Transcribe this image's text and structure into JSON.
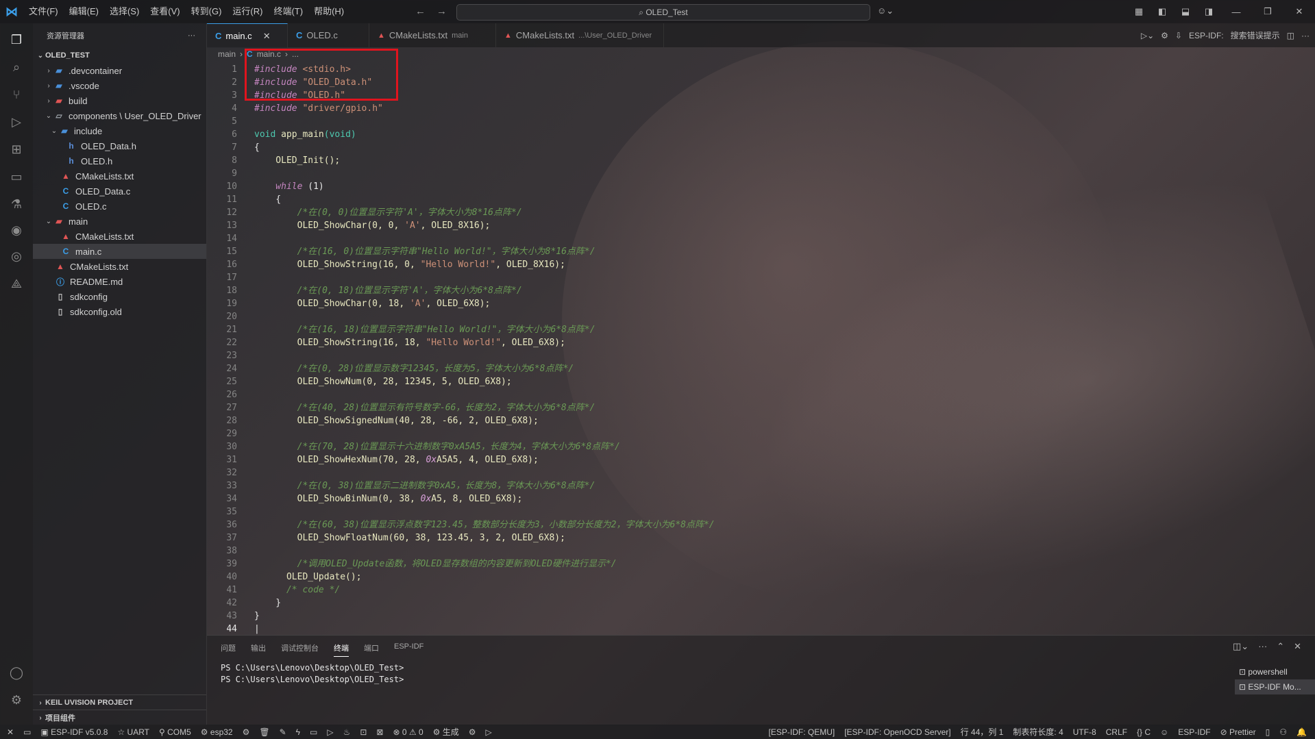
{
  "titlebar": {
    "menu": [
      "文件(F)",
      "编辑(E)",
      "选择(S)",
      "查看(V)",
      "转到(G)",
      "运行(R)",
      "终端(T)",
      "帮助(H)"
    ],
    "search_text": "OLED_Test"
  },
  "sidebar": {
    "title": "资源管理器",
    "root": "OLED_TEST",
    "items": [
      {
        "label": ".devcontainer"
      },
      {
        "label": ".vscode"
      },
      {
        "label": "build"
      },
      {
        "label": "components \\ User_OLED_Driver"
      },
      {
        "label": "include"
      },
      {
        "label": "OLED_Data.h"
      },
      {
        "label": "OLED.h"
      },
      {
        "label": "CMakeLists.txt"
      },
      {
        "label": "OLED_Data.c"
      },
      {
        "label": "OLED.c"
      },
      {
        "label": "main"
      },
      {
        "label": "CMakeLists.txt"
      },
      {
        "label": "main.c"
      },
      {
        "label": "CMakeLists.txt"
      },
      {
        "label": "README.md"
      },
      {
        "label": "sdkconfig"
      },
      {
        "label": "sdkconfig.old"
      }
    ],
    "sections": [
      "KEIL UVISION PROJECT",
      "项目组件"
    ]
  },
  "tabs": [
    {
      "label": "main.c",
      "desc": ""
    },
    {
      "label": "OLED.c",
      "desc": ""
    },
    {
      "label": "CMakeLists.txt",
      "desc": "main"
    },
    {
      "label": "CMakeLists.txt",
      "desc": "...\\User_OLED_Driver"
    }
  ],
  "editor_actions": {
    "esp_idf": "ESP-IDF:",
    "search_hint": "搜索错误提示"
  },
  "breadcrumb": {
    "folder": "main",
    "file": "main.c",
    "more": "..."
  },
  "code": {
    "line_numbers": [
      "1",
      "2",
      "3",
      "4",
      "5",
      "6",
      "7",
      "8",
      "9",
      "10",
      "11",
      "12",
      "13",
      "14",
      "15",
      "16",
      "17",
      "18",
      "19",
      "20",
      "21",
      "22",
      "23",
      "24",
      "25",
      "26",
      "27",
      "28",
      "29",
      "30",
      "31",
      "32",
      "33",
      "34",
      "35",
      "36",
      "37",
      "38",
      "39",
      "40",
      "41",
      "42",
      "43",
      "44"
    ],
    "inc1": "#include",
    "inc1_file": " <stdio.h>",
    "inc2": "#include",
    "inc2_file": " \"OLED_Data.h\"",
    "inc3": "#include",
    "inc3_file": " \"OLED.h\"",
    "inc4": "#include",
    "inc4_file": " \"driver/gpio.h\"",
    "l6_void": "void",
    "l6_fn": " app_main",
    "l6_rest": "(void)",
    "l7": "{",
    "l8": "    OLED_Init();",
    "l10_kw": "    while",
    "l10_rest": " (1)",
    "l11": "    {",
    "l12": "        /*在(0, 0)位置显示字符'A'，字体大小为8*16点阵*/",
    "l13a": "        OLED_ShowChar(0, 0, ",
    "l13s": "'A'",
    "l13b": ", OLED_8X16);",
    "l15": "        /*在(16, 0)位置显示字符串\"Hello World!\"，字体大小为8*16点阵*/",
    "l16a": "        OLED_ShowString(16, 0, ",
    "l16s": "\"Hello World!\"",
    "l16b": ", OLED_8X16);",
    "l18": "        /*在(0, 18)位置显示字符'A'，字体大小为6*8点阵*/",
    "l19a": "        OLED_ShowChar(0, 18, ",
    "l19s": "'A'",
    "l19b": ", OLED_6X8);",
    "l21": "        /*在(16, 18)位置显示字符串\"Hello World!\"，字体大小为6*8点阵*/",
    "l22a": "        OLED_ShowString(16, 18, ",
    "l22s": "\"Hello World!\"",
    "l22b": ", OLED_6X8);",
    "l24": "        /*在(0, 28)位置显示数字12345，长度为5，字体大小为6*8点阵*/",
    "l25": "        OLED_ShowNum(0, 28, 12345, 5, OLED_6X8);",
    "l27": "        /*在(40, 28)位置显示有符号数字-66，长度为2，字体大小为6*8点阵*/",
    "l28": "        OLED_ShowSignedNum(40, 28, -66, 2, OLED_6X8);",
    "l30": "        /*在(70, 28)位置显示十六进制数字0xA5A5，长度为4，字体大小为6*8点阵*/",
    "l31a": "        OLED_ShowHexNum(70, 28, ",
    "l31h": "0x",
    "l31b": "A5A5, 4, OLED_6X8);",
    "l33": "        /*在(0, 38)位置显示二进制数字0xA5，长度为8，字体大小为6*8点阵*/",
    "l34a": "        OLED_ShowBinNum(0, 38, ",
    "l34h": "0x",
    "l34b": "A5, 8, OLED_6X8);",
    "l36": "        /*在(60, 38)位置显示浮点数字123.45，整数部分长度为3，小数部分长度为2，字体大小为6*8点阵*/",
    "l37": "        OLED_ShowFloatNum(60, 38, 123.45, 3, 2, OLED_6X8);",
    "l39": "        /*调用OLED_Update函数，将OLED显存数组的内容更新到OLED硬件进行显示*/",
    "l40": "      OLED_Update();",
    "l41": "      /* code */",
    "l42": "    }",
    "l43": "}"
  },
  "panel": {
    "tabs": [
      "问题",
      "输出",
      "调试控制台",
      "终端",
      "端口",
      "ESP-IDF"
    ],
    "lines": [
      "PS C:\\Users\\Lenovo\\Desktop\\OLED_Test>",
      "PS C:\\Users\\Lenovo\\Desktop\\OLED_Test>"
    ],
    "terminals": [
      "powershell",
      "ESP-IDF Mo..."
    ]
  },
  "statusbar": {
    "left": [
      "ESP-IDF v5.0.8",
      "UART",
      "COM5",
      "esp32",
      "⊗ 0 ⚠ 0",
      "生成"
    ],
    "right": [
      "[ESP-IDF: QEMU]",
      "[ESP-IDF: OpenOCD Server]",
      "行 44，列 1",
      "制表符长度: 4",
      "UTF-8",
      "CRLF",
      "{} C",
      "ESP-IDF",
      "Prettier"
    ]
  }
}
